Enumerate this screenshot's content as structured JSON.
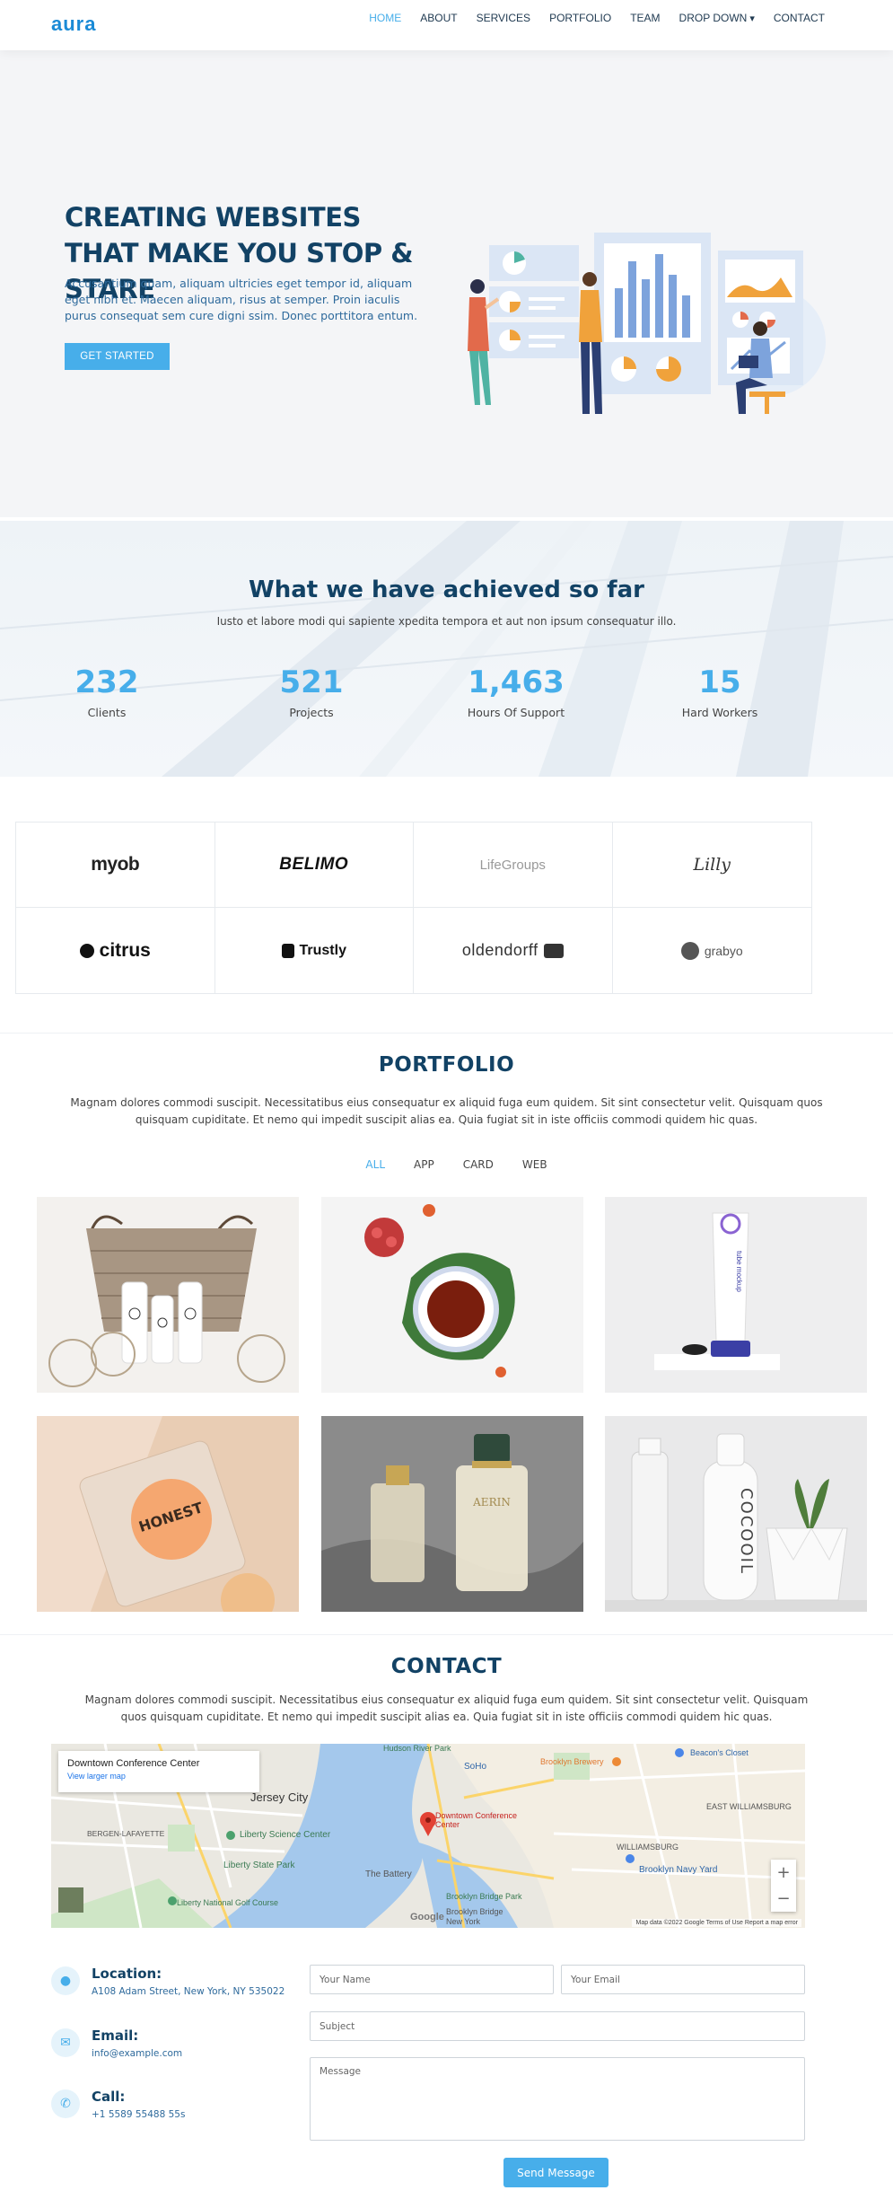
{
  "header": {
    "logo": "aura",
    "nav": [
      "HOME",
      "ABOUT",
      "SERVICES",
      "PORTFOLIO",
      "TEAM",
      "DROP DOWN",
      "CONTACT"
    ]
  },
  "hero": {
    "title": "CREATING WEBSITES THAT MAKE YOU STOP & STARE",
    "text": "Accusantium quam, aliquam ultricies eget tempor id, aliquam eget nibh et. Maecen aliquam, risus at semper. Proin iaculis purus consequat sem cure digni ssim. Donec porttitora entum.",
    "cta": "GET STARTED"
  },
  "counts": {
    "title": "What we have achieved so far",
    "subtitle": "Iusto et labore modi qui sapiente xpedita tempora et aut non ipsum consequatur illo.",
    "items": [
      {
        "value": "232",
        "label": "Clients"
      },
      {
        "value": "521",
        "label": "Projects"
      },
      {
        "value": "1,463",
        "label": "Hours Of Support"
      },
      {
        "value": "15",
        "label": "Hard Workers"
      }
    ]
  },
  "clients": [
    "myob",
    "BELIMO",
    "LifeGroups",
    "Lilly",
    "citrus",
    "Trustly",
    "oldendorff",
    "grabyo"
  ],
  "portfolio": {
    "title": "PORTFOLIO",
    "text": "Magnam dolores commodi suscipit. Necessitatibus eius consequatur ex aliquid fuga eum quidem. Sit sint consectetur velit. Quisquam quos quisquam cupiditate. Et nemo qui impedit suscipit alias ea. Quia fugiat sit in iste officiis commodi quidem hic quas.",
    "filters": [
      "ALL",
      "APP",
      "CARD",
      "WEB"
    ],
    "honest": "HONEST",
    "cocool": "COCOOIL",
    "tube": "tube mockup"
  },
  "contact": {
    "title": "CONTACT",
    "text": "Magnam dolores commodi suscipit. Necessitatibus eius consequatur ex aliquid fuga eum quidem. Sit sint consectetur velit. Quisquam quos quisquam cupiditate. Et nemo qui impedit suscipit alias ea. Quia fugiat sit in iste officiis commodi quidem hic quas.",
    "map": {
      "card_title": "Downtown Conference Center",
      "card_link": "View larger map",
      "pin_label": "Downtown Conference Center",
      "footer": "Map data ©2022 Google   Terms of Use   Report a map error",
      "google": "Google",
      "places": [
        "Jersey City",
        "BERGEN-LAFAYETTE",
        "Liberty Science Center",
        "Liberty State Park",
        "WILLIAMSBURG",
        "Brooklyn Navy Yard",
        "Brooklyn Bridge Park",
        "The Battery",
        "SoHo",
        "Brooklyn Brewery",
        "Beacon's Closet",
        "EAST WILLIAMSBURG",
        "Hudson River Park",
        "Liberty National Golf Course",
        "Brooklyn Bridge",
        "New York"
      ]
    },
    "info": [
      {
        "label": "Location:",
        "value": "A108 Adam Street, New York, NY 535022"
      },
      {
        "label": "Email:",
        "value": "info@example.com"
      },
      {
        "label": "Call:",
        "value": "+1 5589 55488 55s"
      }
    ],
    "form": {
      "name": "Your Name",
      "email": "Your Email",
      "subject": "Subject",
      "message": "Message",
      "send": "Send Message"
    }
  }
}
